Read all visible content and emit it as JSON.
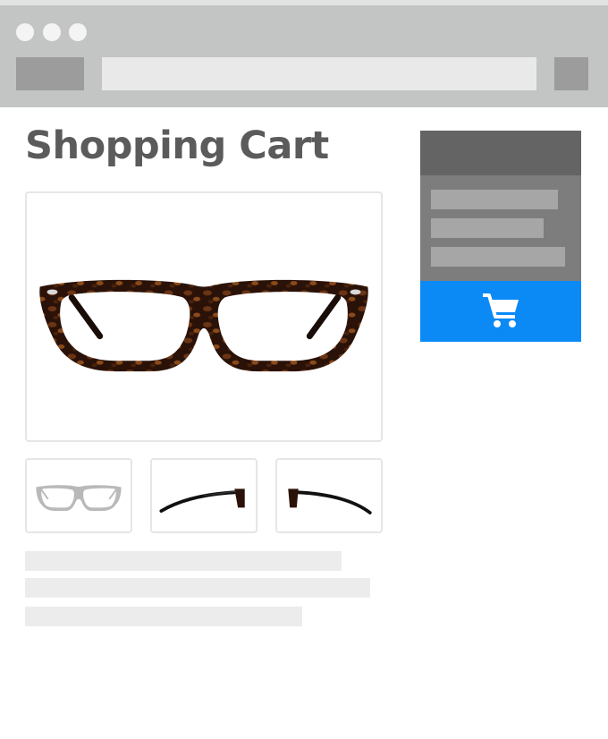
{
  "page": {
    "title": "Shopping Cart"
  },
  "colors": {
    "chrome": "#c3c4c4",
    "accent": "#0b8af5",
    "title": "#5b5b5b"
  },
  "product": {
    "main_image": "eyeglasses-front-tortoise",
    "thumbnails": [
      "eyeglasses-front-gray",
      "eyeglasses-side-black",
      "eyeglasses-side-black-reverse"
    ]
  },
  "summary": {
    "add_to_cart_icon": "shopping-cart-icon"
  }
}
